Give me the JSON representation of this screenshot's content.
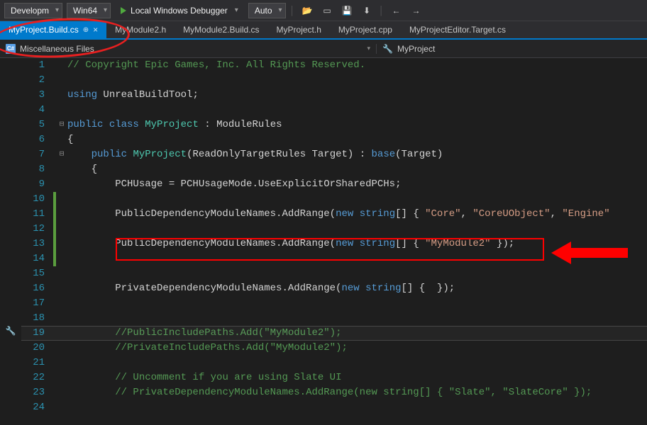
{
  "toolbar": {
    "config": "Developm",
    "platform": "Win64",
    "debugger": "Local Windows Debugger",
    "mode": "Auto",
    "icons": [
      "folder-open",
      "open-file",
      "save-all",
      "download",
      "nav-back",
      "nav-fwd"
    ]
  },
  "tabs": [
    {
      "label": "MyProject.Build.cs",
      "active": true,
      "pinned": true
    },
    {
      "label": "MyModule2.h",
      "active": false
    },
    {
      "label": "MyModule2.Build.cs",
      "active": false
    },
    {
      "label": "MyProject.h",
      "active": false
    },
    {
      "label": "MyProject.cpp",
      "active": false
    },
    {
      "label": "MyProjectEditor.Target.cs",
      "active": false
    }
  ],
  "crumb": {
    "left": "Miscellaneous Files",
    "right": "MyProject"
  },
  "lines": [
    {
      "n": 1,
      "fold": "",
      "txt": [
        {
          "c": "c-comment",
          "t": "// Copyright Epic Games, Inc. All Rights Reserved."
        }
      ]
    },
    {
      "n": 2,
      "fold": "",
      "txt": []
    },
    {
      "n": 3,
      "fold": "",
      "txt": [
        {
          "c": "c-keyword",
          "t": "using"
        },
        {
          "c": "c-plain",
          "t": " UnrealBuildTool;"
        }
      ]
    },
    {
      "n": 4,
      "fold": "",
      "txt": []
    },
    {
      "n": 5,
      "fold": "⊟",
      "txt": [
        {
          "c": "c-keyword",
          "t": "public"
        },
        {
          "c": "c-plain",
          "t": " "
        },
        {
          "c": "c-keyword",
          "t": "class"
        },
        {
          "c": "c-plain",
          "t": " "
        },
        {
          "c": "c-type",
          "t": "MyProject"
        },
        {
          "c": "c-plain",
          "t": " : ModuleRules"
        }
      ]
    },
    {
      "n": 6,
      "fold": "",
      "txt": [
        {
          "c": "c-plain",
          "t": "{"
        }
      ]
    },
    {
      "n": 7,
      "fold": "⊟",
      "txt": [
        {
          "c": "c-plain",
          "t": "    "
        },
        {
          "c": "c-keyword",
          "t": "public"
        },
        {
          "c": "c-plain",
          "t": " "
        },
        {
          "c": "c-type",
          "t": "MyProject"
        },
        {
          "c": "c-plain",
          "t": "(ReadOnlyTargetRules Target) : "
        },
        {
          "c": "c-base",
          "t": "base"
        },
        {
          "c": "c-plain",
          "t": "(Target)"
        }
      ]
    },
    {
      "n": 8,
      "fold": "",
      "txt": [
        {
          "c": "c-plain",
          "t": "    {"
        }
      ]
    },
    {
      "n": 9,
      "fold": "",
      "txt": [
        {
          "c": "c-plain",
          "t": "        PCHUsage = PCHUsageMode.UseExplicitOrSharedPCHs;"
        }
      ]
    },
    {
      "n": 10,
      "fold": "",
      "green": true,
      "txt": []
    },
    {
      "n": 11,
      "fold": "",
      "green": true,
      "txt": [
        {
          "c": "c-plain",
          "t": "        PublicDependencyModuleNames.AddRange("
        },
        {
          "c": "c-keyword",
          "t": "new"
        },
        {
          "c": "c-plain",
          "t": " "
        },
        {
          "c": "c-keyword",
          "t": "string"
        },
        {
          "c": "c-plain",
          "t": "[] { "
        },
        {
          "c": "c-str",
          "t": "\"Core\""
        },
        {
          "c": "c-plain",
          "t": ", "
        },
        {
          "c": "c-str",
          "t": "\"CoreUObject\""
        },
        {
          "c": "c-plain",
          "t": ", "
        },
        {
          "c": "c-str",
          "t": "\"Engine\""
        }
      ]
    },
    {
      "n": 12,
      "fold": "",
      "green": true,
      "txt": []
    },
    {
      "n": 13,
      "fold": "",
      "green": true,
      "txt": [
        {
          "c": "c-plain",
          "t": "        PublicDependencyModuleNames.AddRange("
        },
        {
          "c": "c-keyword",
          "t": "new"
        },
        {
          "c": "c-plain",
          "t": " "
        },
        {
          "c": "c-keyword",
          "t": "string"
        },
        {
          "c": "c-plain",
          "t": "[] { "
        },
        {
          "c": "c-str",
          "t": "\"MyModule2\""
        },
        {
          "c": "c-plain",
          "t": " });"
        }
      ]
    },
    {
      "n": 14,
      "fold": "",
      "green": true,
      "txt": []
    },
    {
      "n": 15,
      "fold": "",
      "txt": []
    },
    {
      "n": 16,
      "fold": "",
      "txt": [
        {
          "c": "c-plain",
          "t": "        PrivateDependencyModuleNames.AddRange("
        },
        {
          "c": "c-keyword",
          "t": "new"
        },
        {
          "c": "c-plain",
          "t": " "
        },
        {
          "c": "c-keyword",
          "t": "string"
        },
        {
          "c": "c-plain",
          "t": "[] {  });"
        }
      ]
    },
    {
      "n": 17,
      "fold": "",
      "txt": []
    },
    {
      "n": 18,
      "fold": "",
      "txt": []
    },
    {
      "n": 19,
      "fold": "",
      "hl": true,
      "txt": [
        {
          "c": "c-plain",
          "t": "        "
        },
        {
          "c": "c-comment",
          "t": "//PublicIncludePaths.Add(\"MyModule2\");"
        }
      ]
    },
    {
      "n": 20,
      "fold": "",
      "txt": [
        {
          "c": "c-plain",
          "t": "        "
        },
        {
          "c": "c-comment",
          "t": "//PrivateIncludePaths.Add(\"MyModule2\");"
        }
      ]
    },
    {
      "n": 21,
      "fold": "",
      "txt": []
    },
    {
      "n": 22,
      "fold": "",
      "txt": [
        {
          "c": "c-plain",
          "t": "        "
        },
        {
          "c": "c-comment",
          "t": "// Uncomment if you are using Slate UI"
        }
      ]
    },
    {
      "n": 23,
      "fold": "",
      "txt": [
        {
          "c": "c-plain",
          "t": "        "
        },
        {
          "c": "c-comment",
          "t": "// PrivateDependencyModuleNames.AddRange(new string[] { \"Slate\", \"SlateCore\" });"
        }
      ]
    },
    {
      "n": 24,
      "fold": "",
      "txt": []
    }
  ],
  "annotation_colors": {
    "highlight": "#ff0000",
    "arrow": "#ff0000",
    "ellipse": "#e82020"
  }
}
